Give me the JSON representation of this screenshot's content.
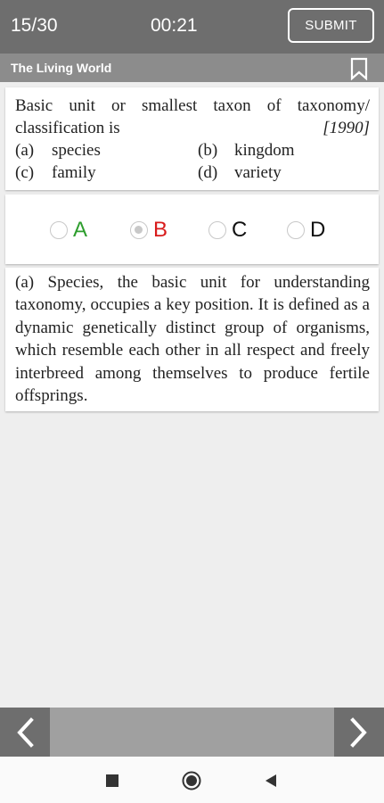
{
  "header": {
    "counter": "15/30",
    "timer": "00:21",
    "submit_label": "SUBMIT"
  },
  "subheader": {
    "chapter_title": "The Living World",
    "bookmark_icon": "bookmark-icon"
  },
  "question": {
    "line1": "Basic unit or smallest taxon of taxonomy/",
    "line2": "classification is",
    "year": "[1990]",
    "options": [
      {
        "label": "(a)",
        "text": "species"
      },
      {
        "label": "(b)",
        "text": "kingdom"
      },
      {
        "label": "(c)",
        "text": "family"
      },
      {
        "label": "(d)",
        "text": "variety"
      }
    ]
  },
  "choices": [
    {
      "letter": "A",
      "color": "#2e9e2e",
      "selected": false
    },
    {
      "letter": "B",
      "color": "#d81b1b",
      "selected": true
    },
    {
      "letter": "C",
      "color": "#111111",
      "selected": false
    },
    {
      "letter": "D",
      "color": "#111111",
      "selected": false
    }
  ],
  "answer": {
    "text": "(a)  Species, the basic unit for understanding taxonomy, occupies a key position. It is defined as a dynamic genetically distinct group of organisms, which resemble each other in all respect and freely interbreed among themselves to produce fertile offsprings."
  },
  "navigation": {
    "prev_icon": "chevron-left-icon",
    "next_icon": "chevron-right-icon"
  },
  "system_nav": {
    "recents_icon": "square-icon",
    "home_icon": "circle-icon",
    "back_icon": "triangle-back-icon"
  }
}
